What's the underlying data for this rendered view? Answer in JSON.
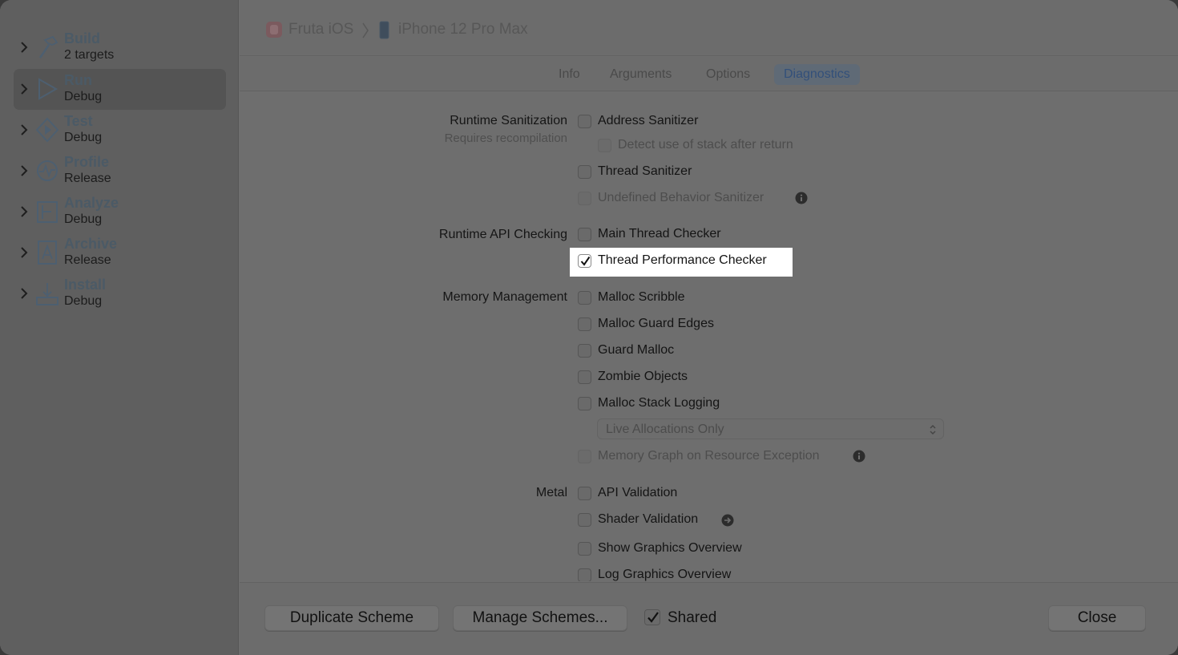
{
  "sidebar": {
    "items": [
      {
        "title": "Build",
        "subtitle": "2 targets",
        "icon": "hammer-icon"
      },
      {
        "title": "Run",
        "subtitle": "Debug",
        "icon": "play-icon"
      },
      {
        "title": "Test",
        "subtitle": "Debug",
        "icon": "diamond-play-icon"
      },
      {
        "title": "Profile",
        "subtitle": "Release",
        "icon": "waveform-icon"
      },
      {
        "title": "Analyze",
        "subtitle": "Debug",
        "icon": "analyze-icon"
      },
      {
        "title": "Archive",
        "subtitle": "Release",
        "icon": "archive-icon"
      },
      {
        "title": "Install",
        "subtitle": "Debug",
        "icon": "install-icon"
      }
    ],
    "selected": "Run"
  },
  "header": {
    "scheme": "Fruta iOS",
    "device": "iPhone 12 Pro Max"
  },
  "tabs": [
    "Info",
    "Arguments",
    "Options",
    "Diagnostics"
  ],
  "active_tab": "Diagnostics",
  "sections": {
    "runtime_sanitization": {
      "label": "Runtime Sanitization",
      "sublabel": "Requires recompilation",
      "address_sanitizer": "Address Sanitizer",
      "detect_stack": "Detect use of stack after return",
      "thread_sanitizer": "Thread Sanitizer",
      "ub_sanitizer": "Undefined Behavior Sanitizer"
    },
    "runtime_api": {
      "label": "Runtime API Checking",
      "main_thread_checker": "Main Thread Checker",
      "thread_perf_checker": "Thread Performance Checker"
    },
    "memory": {
      "label": "Memory Management",
      "malloc_scribble": "Malloc Scribble",
      "malloc_guard_edges": "Malloc Guard Edges",
      "guard_malloc": "Guard Malloc",
      "zombie_objects": "Zombie Objects",
      "malloc_stack_logging": "Malloc Stack Logging",
      "logging_mode": "Live Allocations Only",
      "memory_graph": "Memory Graph on Resource Exception"
    },
    "metal": {
      "label": "Metal",
      "api_validation": "API Validation",
      "shader_validation": "Shader Validation",
      "show_graphics_overview": "Show Graphics Overview",
      "log_graphics_overview": "Log Graphics Overview"
    }
  },
  "footer": {
    "duplicate": "Duplicate Scheme",
    "manage": "Manage Schemes...",
    "shared": "Shared",
    "close": "Close"
  },
  "colors": {
    "highlight": "#ffffff",
    "active_tab_text": "#33507a"
  }
}
